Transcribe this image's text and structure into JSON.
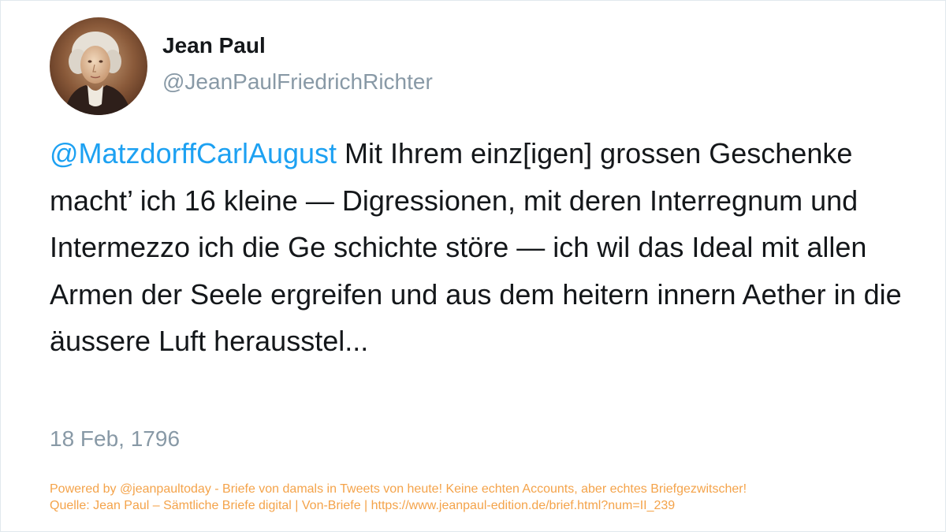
{
  "user": {
    "display_name": "Jean Paul",
    "handle": "@JeanPaulFriedrichRichter",
    "avatar": "portrait-avatar"
  },
  "tweet": {
    "mention": "@MatzdorffCarlAugust",
    "text": "Mit Ihrem einz[igen] grossen Geschenke macht’ ich 16 kleine — Digressionen, mit deren Interregnum und Intermezzo ich die Ge schichte störe — ich wil das Ideal mit allen Armen der Seele ergreifen und aus dem heitern innern Aether in die äussere Luft herausstel...",
    "date": "18 Feb, 1796"
  },
  "footer": {
    "line1": "Powered by @jeanpaultoday - Briefe von damals in Tweets von heute! Keine echten Accounts, aber echtes Briefgezwitscher!",
    "line2": "Quelle: Jean Paul – Sämtliche Briefe digital | Von-Briefe | https://www.jeanpaul-edition.de/brief.html?num=II_239"
  },
  "colors": {
    "mention": "#1da1f2",
    "text": "#14171a",
    "muted": "#8899a6",
    "footer": "#f4a34a"
  }
}
